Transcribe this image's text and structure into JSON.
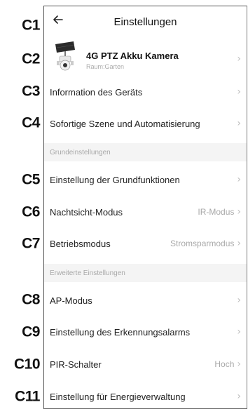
{
  "header": {
    "title": "Einstellungen",
    "back_icon": "arrow-left-icon"
  },
  "codes": [
    "C1",
    "C2",
    "C3",
    "C4",
    "C5",
    "C6",
    "C7",
    "C8",
    "C9",
    "C10",
    "C11"
  ],
  "device": {
    "name": "4G PTZ Akku Kamera",
    "room": "Raum:Garten",
    "icon": "solar-ptz-camera-icon"
  },
  "rows": {
    "info": "Information des Geräts",
    "scene": "Sofortige Szene und Automatisierung",
    "basic": "Einstellung der Grundfunktionen",
    "night": "Nachtsicht-Modus",
    "night_value": "IR-Modus",
    "mode": "Betriebsmodus",
    "mode_value": "Stromsparmodus",
    "ap": "AP-Modus",
    "alarm": "Einstellung des Erkennungsalarms",
    "pir": "PIR-Schalter",
    "pir_value": "Hoch",
    "energy": "Einstellung für Energieverwaltung"
  },
  "sections": {
    "basic": "Grundeinstellungen",
    "advanced": "Erweiterte Einstellungen"
  },
  "colors": {
    "secondary_text": "#a8a8a8",
    "section_bg": "#f4f4f4",
    "chevron": "#bdbdbd"
  }
}
